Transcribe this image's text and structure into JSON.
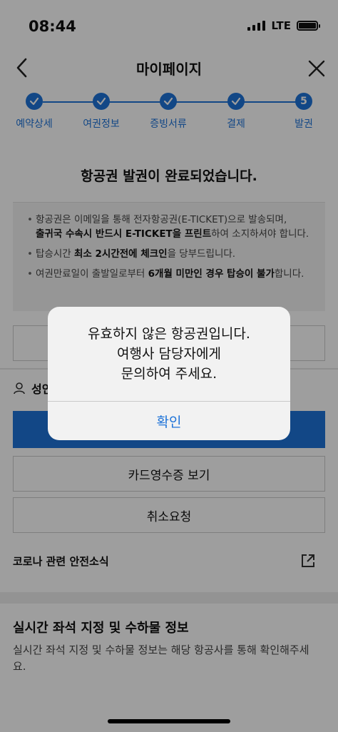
{
  "status_bar": {
    "time": "08:44",
    "network": "LTE"
  },
  "nav": {
    "title": "마이페이지",
    "back_icon": "chevron-left-icon",
    "close_icon": "close-icon"
  },
  "steps": [
    {
      "label": "예약상세",
      "state": "done"
    },
    {
      "label": "여권정보",
      "state": "done"
    },
    {
      "label": "증빙서류",
      "state": "done"
    },
    {
      "label": "결제",
      "state": "done"
    },
    {
      "label": "발권",
      "state": "current",
      "number": "5"
    }
  ],
  "notice": {
    "title": "항공권 발권이 완료되었습니다.",
    "item1_a": "항공권은 이메일을 통해 전자항공권(E-TICKET)으로 발송되며,",
    "item1_b": "출귀국 수속시 반드시 E-TICKET을 프린트",
    "item1_c": "하여 소지하셔야 합니다.",
    "item2_a": "탑승시간 ",
    "item2_b": "최소 2시간전에 체크인",
    "item2_c": "을 당부드립니다.",
    "item3_a": "여권만료일이 출발일로부터 ",
    "item3_b": "6개월 미만인 경우 탑승이 불가",
    "item3_c": "합니다."
  },
  "passenger_label": "성인",
  "buttons": {
    "card_receipt": "카드영수증 보기",
    "cancel_request": "취소요청"
  },
  "news": {
    "label": "코로나 관련 안전소식",
    "icon": "external-link-icon"
  },
  "seat_info": {
    "title": "실시간 좌석 지정 및 수하물 정보",
    "description": "실시간 좌석 지정 및 수하물 정보는 해당 항공사를 통해 확인해주세요."
  },
  "alert": {
    "line1": "유효하지 않은 항공권입니다.",
    "line2": "여행사 담당자에게",
    "line3": "문의하여 주세요.",
    "confirm": "확인"
  },
  "colors": {
    "accent": "#1e73d8"
  }
}
